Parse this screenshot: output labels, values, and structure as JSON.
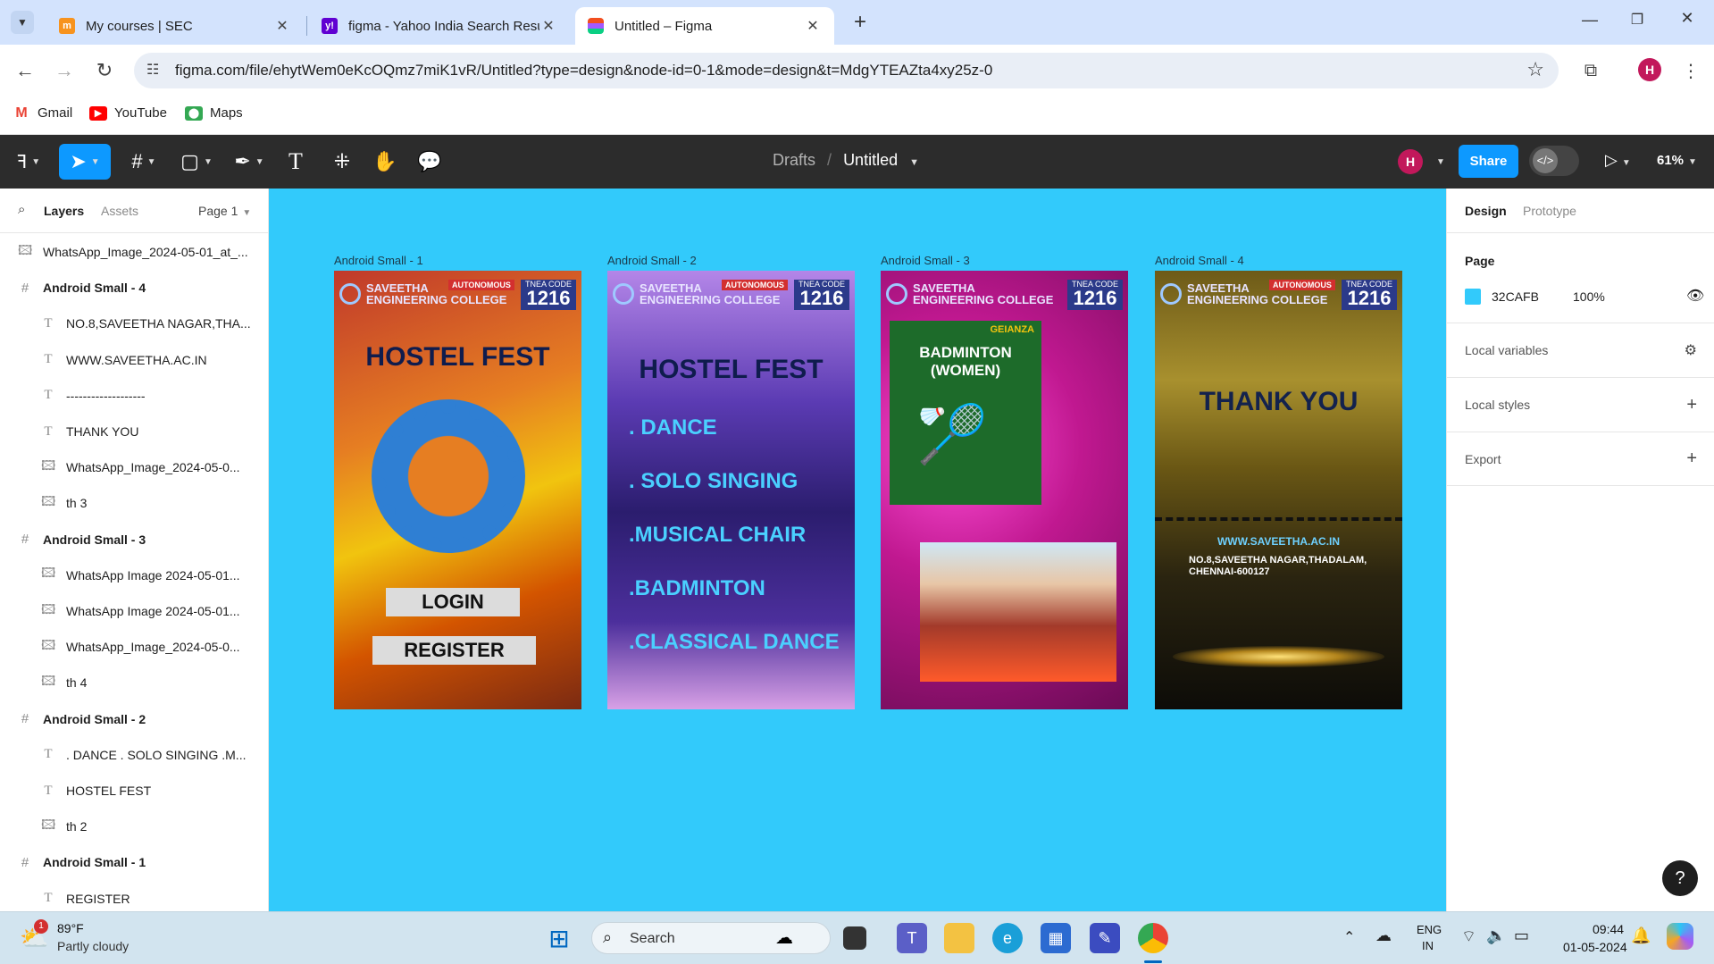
{
  "browser": {
    "tabs": [
      {
        "title": "My courses | SEC",
        "favicon": "moodle-icon",
        "active": false
      },
      {
        "title": "figma - Yahoo India Search Resu",
        "favicon": "yahoo-icon",
        "active": false
      },
      {
        "title": "Untitled – Figma",
        "favicon": "figma-icon",
        "active": true
      }
    ],
    "new_tab": "+",
    "url": "figma.com/file/ehytWem0eKcOQmz7miK1vR/Untitled?type=design&node-id=0-1&mode=design&t=MdgYTEAZta4xy25z-0",
    "profile_initial": "H",
    "bookmarks": [
      {
        "label": "Gmail",
        "icon": "gmail-icon"
      },
      {
        "label": "YouTube",
        "icon": "youtube-icon"
      },
      {
        "label": "Maps",
        "icon": "maps-icon"
      }
    ]
  },
  "figma": {
    "breadcrumb": {
      "project": "Drafts",
      "separator": "/",
      "file": "Untitled"
    },
    "user_initial": "H",
    "share_label": "Share",
    "zoom": "61%",
    "left_panel": {
      "tabs": {
        "layers": "Layers",
        "assets": "Assets"
      },
      "page": "Page 1",
      "layers": [
        {
          "name": "WhatsApp_Image_2024-05-01_at_...",
          "type": "image",
          "indent": 0
        },
        {
          "name": "Android Small - 4",
          "type": "frame",
          "indent": 0
        },
        {
          "name": "NO.8,SAVEETHA NAGAR,THA...",
          "type": "text",
          "indent": 1
        },
        {
          "name": "WWW.SAVEETHA.AC.IN",
          "type": "text",
          "indent": 1
        },
        {
          "name": "-------------------",
          "type": "text",
          "indent": 1
        },
        {
          "name": "THANK YOU",
          "type": "text",
          "indent": 1
        },
        {
          "name": "WhatsApp_Image_2024-05-0...",
          "type": "image",
          "indent": 1
        },
        {
          "name": "th 3",
          "type": "image",
          "indent": 1
        },
        {
          "name": "Android Small - 3",
          "type": "frame",
          "indent": 0
        },
        {
          "name": "WhatsApp Image 2024-05-01...",
          "type": "image",
          "indent": 1
        },
        {
          "name": "WhatsApp Image 2024-05-01...",
          "type": "image",
          "indent": 1
        },
        {
          "name": "WhatsApp_Image_2024-05-0...",
          "type": "image",
          "indent": 1
        },
        {
          "name": "th 4",
          "type": "image",
          "indent": 1
        },
        {
          "name": "Android Small - 2",
          "type": "frame",
          "indent": 0
        },
        {
          "name": ". DANCE . SOLO SINGING .M...",
          "type": "text",
          "indent": 1
        },
        {
          "name": "HOSTEL FEST",
          "type": "text",
          "indent": 1
        },
        {
          "name": "th 2",
          "type": "image",
          "indent": 1
        },
        {
          "name": "Android Small - 1",
          "type": "frame",
          "indent": 0
        },
        {
          "name": "REGISTER",
          "type": "text",
          "indent": 1
        }
      ]
    },
    "canvas": {
      "background": "#32CAFB",
      "frames": [
        {
          "label": "Android Small - 1"
        },
        {
          "label": "Android Small - 2"
        },
        {
          "label": "Android Small - 3"
        },
        {
          "label": "Android Small - 4"
        }
      ],
      "college": {
        "name_line1": "SAVEETHA",
        "name_line2": "ENGINEERING COLLEGE",
        "autonomous": "AUTONOMOUS",
        "tnea_label": "TNEA CODE",
        "tnea_code": "1216"
      },
      "frame1": {
        "title": "HOSTEL FEST",
        "login": "LOGIN",
        "register": "REGISTER"
      },
      "frame2": {
        "title": "HOSTEL FEST",
        "items": [
          ". DANCE",
          ". SOLO SINGING",
          ".MUSICAL CHAIR",
          ".BADMINTON",
          ".CLASSICAL DANCE"
        ]
      },
      "frame3": {
        "poster_title": "BADMINTON (WOMEN)",
        "poster_brand": "GEIANZA"
      },
      "frame4": {
        "thanks": "THANK YOU",
        "website": "WWW.SAVEETHA.AC.IN",
        "address": "NO.8,SAVEETHA NAGAR,THADALAM, CHENNAI-600127"
      }
    },
    "right_panel": {
      "tabs": {
        "design": "Design",
        "prototype": "Prototype"
      },
      "page_heading": "Page",
      "page_color": "32CAFB",
      "page_opacity": "100%",
      "sections": [
        "Local variables",
        "Local styles",
        "Export"
      ]
    },
    "help": "?"
  },
  "taskbar": {
    "weather_temp": "89°F",
    "weather_desc": "Partly cloudy",
    "weather_badge": "1",
    "search_label": "Search",
    "lang_line1": "ENG",
    "lang_line2": "IN",
    "time": "09:44",
    "date": "01-05-2024"
  }
}
